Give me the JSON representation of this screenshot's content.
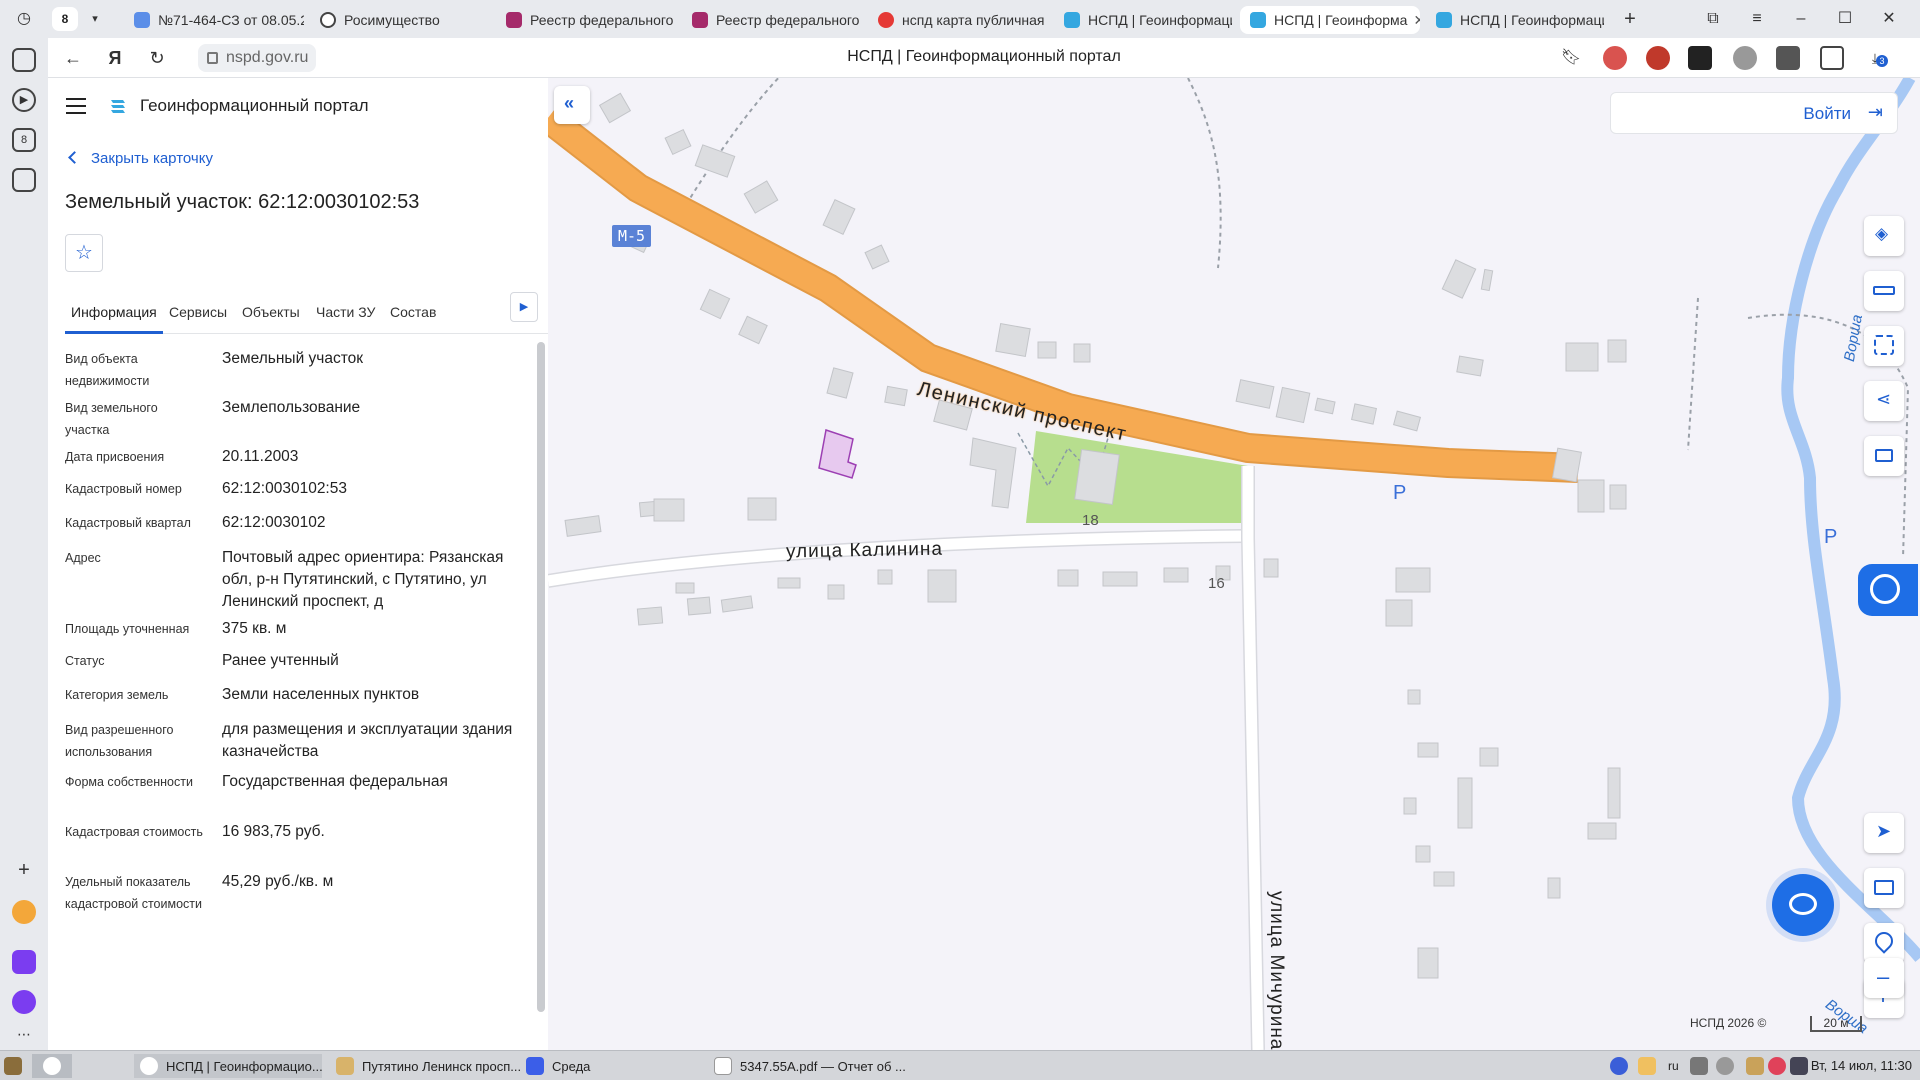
{
  "browser": {
    "tab_count": "8",
    "tabs": [
      {
        "title": "№71-464-СЗ от 08.05.2("
      },
      {
        "title": "Росимущество"
      },
      {
        "title": "Реестр федерального и"
      },
      {
        "title": "Реестр федерального и"
      },
      {
        "title": "нспд карта публичная"
      },
      {
        "title": "НСПД | Геоинформаци"
      },
      {
        "title": "НСПД | Геоинформа"
      },
      {
        "title": "НСПД | Геоинформаци"
      }
    ],
    "url": "nspd.gov.ru",
    "page_title": "НСПД | Геоинформационный портал",
    "download_badge": "3"
  },
  "panel": {
    "portal_name": "Геоинформационный портал",
    "close_card": "Закрыть карточку",
    "title": "Земельный участок: 62:12:0030102:53",
    "tabs": [
      "Информация",
      "Сервисы",
      "Объекты",
      "Части ЗУ",
      "Состав"
    ],
    "attributes": [
      {
        "label": "Вид объекта недвижимости",
        "value": "Земельный участок"
      },
      {
        "label": "Вид земельного участка",
        "value": "Землепользование"
      },
      {
        "label": "Дата присвоения",
        "value": "20.11.2003"
      },
      {
        "label": "Кадастровый номер",
        "value": "62:12:0030102:53"
      },
      {
        "label": "Кадастровый квартал",
        "value": "62:12:0030102"
      },
      {
        "label": "Адрес",
        "value": "Почтовый адрес ориентира: Рязанская обл, р-н Путятинский, с Путятино, ул Ленинский проспект, д"
      },
      {
        "label": "Площадь уточненная",
        "value": "375 кв. м"
      },
      {
        "label": "Статус",
        "value": "Ранее учтенный"
      },
      {
        "label": "Категория земель",
        "value": "Земли населенных пунктов"
      },
      {
        "label": "Вид разрешенного использования",
        "value": "для размещения и эксплуатации здания казначейства"
      },
      {
        "label": "Форма собственности",
        "value": "Государственная федеральная"
      },
      {
        "label": "Кадастровая стоимость",
        "value": "16 983,75 руб."
      },
      {
        "label": "Удельный показатель кадастровой стоимости",
        "value": "45,29 руб./кв. м"
      }
    ]
  },
  "map": {
    "login": "Войти",
    "road_badge": "М-5",
    "street_main": "Ленинский проспект",
    "street_kalinina": "улица Калинина",
    "street_michurina": "улица Мичурина",
    "river_1": "Ворша",
    "river_2": "Ворша",
    "house_18": "18",
    "house_16": "16",
    "parking_1": "P",
    "parking_2": "P",
    "copyright": "НСПД 2026 ©",
    "scale": "20 м",
    "colors": {
      "road": "#f6aa52",
      "parcel": "#e7c9ef",
      "green": "#b7de8e",
      "river": "#a7c8f4",
      "accent": "#1f5fd1"
    }
  },
  "taskbar": {
    "items": [
      "НСПД | Геоинформацио...",
      "Путятино Ленинск просп...",
      "Среда",
      "5347.55А.pdf — Отчет об ..."
    ],
    "lang": "ru",
    "clock": "Вт, 14 июл, 11:30"
  }
}
